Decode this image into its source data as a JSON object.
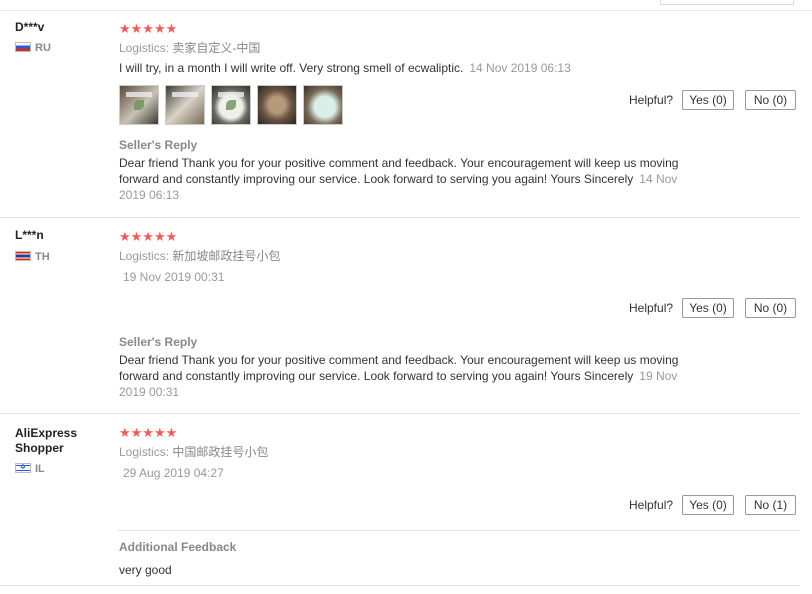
{
  "reviews": [
    {
      "user": "D***v",
      "country": "RU",
      "stars": "★★★★★",
      "logistics_label": "Logistics:",
      "logistics_value": "卖家自定义-中国",
      "comment": "I will try, in a month I will write off. Very strong smell of ecwaliptic.",
      "date": "14 Nov 2019 06:13",
      "helpful_label": "Helpful?",
      "yes_label": "Yes (0)",
      "no_label": "No (0)",
      "reply_title": "Seller's Reply",
      "reply_text": "Dear friend Thank you for your positive comment and feedback. Your encouragement will keep us moving forward and constantly improving our service. Look forward to serving you again! Yours Sincerely",
      "reply_date": "14 Nov 2019 06:13"
    },
    {
      "user": "L***n",
      "country": "TH",
      "stars": "★★★★★",
      "logistics_label": "Logistics:",
      "logistics_value": "新加坡邮政挂号小包",
      "date": "19 Nov 2019 00:31",
      "helpful_label": "Helpful?",
      "yes_label": "Yes (0)",
      "no_label": "No (0)",
      "reply_title": "Seller's Reply",
      "reply_text": "Dear friend Thank you for your positive comment and feedback. Your encouragement will keep us moving forward and constantly improving our service. Look forward to serving you again! Yours Sincerely",
      "reply_date": "19 Nov 2019 00:31"
    },
    {
      "user": "AliExpress Shopper",
      "country": "IL",
      "stars": "★★★★★",
      "logistics_label": "Logistics:",
      "logistics_value": "中国邮政挂号小包",
      "date": "29 Aug 2019 04:27",
      "helpful_label": "Helpful?",
      "yes_label": "Yes (0)",
      "no_label": "No (1)",
      "additional_title": "Additional Feedback",
      "additional_text": "very good"
    }
  ]
}
